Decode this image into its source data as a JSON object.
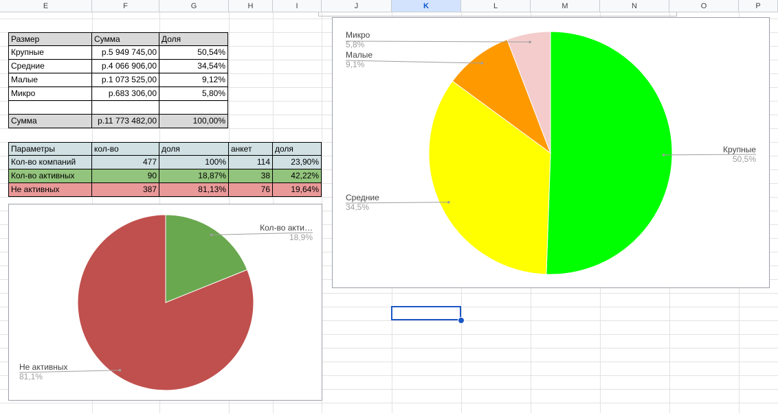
{
  "columns": [
    "E",
    "F",
    "G",
    "H",
    "I",
    "J",
    "K",
    "L",
    "M",
    "N",
    "O",
    "P"
  ],
  "selected_column": "K",
  "size_table": {
    "headers": [
      "Размер",
      "Сумма",
      "Доля"
    ],
    "rows": [
      [
        "Крупные",
        "р.5 949 745,00",
        "50,54%"
      ],
      [
        "Средние",
        "р.4 066 906,00",
        "34,54%"
      ],
      [
        "Малые",
        "р.1 073 525,00",
        "9,12%"
      ],
      [
        "Микро",
        "р.683 306,00",
        "5,80%"
      ],
      [
        "",
        "",
        ""
      ],
      [
        "Сумма",
        "р.11 773 482,00",
        "100,00%"
      ]
    ]
  },
  "params_table": {
    "headers": [
      "Параметры",
      "кол-во",
      "доля",
      "анкет",
      "доля"
    ],
    "rows": [
      [
        "Кол-во компаний",
        "477",
        "100%",
        "114",
        "23,90%"
      ],
      [
        "Кол-во активных",
        "90",
        "18,87%",
        "38",
        "42,22%"
      ],
      [
        "Не активных",
        "387",
        "81,13%",
        "76",
        "19,64%"
      ]
    ]
  },
  "colors": {
    "header_gray": "#d9d9d9",
    "params_header": "#d0e0e3",
    "row_companies": "#d0e0e3",
    "row_active": "#93c47d",
    "row_inactive": "#ea9999"
  },
  "chart_data": [
    {
      "type": "pie",
      "title": "",
      "slices": [
        {
          "label": "Кол-во акти…",
          "value": 18.9,
          "pct_label": "18,9%",
          "color": "#6aa84f"
        },
        {
          "label": "Не активных",
          "value": 81.1,
          "pct_label": "81,1%",
          "color": "#c0504d"
        }
      ]
    },
    {
      "type": "pie",
      "title": "",
      "slices": [
        {
          "label": "Крупные",
          "value": 50.5,
          "pct_label": "50,5%",
          "color": "#00ff00"
        },
        {
          "label": "Средние",
          "value": 34.5,
          "pct_label": "34,5%",
          "color": "#ffff00"
        },
        {
          "label": "Малые",
          "value": 9.1,
          "pct_label": "9,1%",
          "color": "#ff9900"
        },
        {
          "label": "Микро",
          "value": 5.8,
          "pct_label": "5,8%",
          "color": "#f4cccc"
        }
      ]
    }
  ]
}
